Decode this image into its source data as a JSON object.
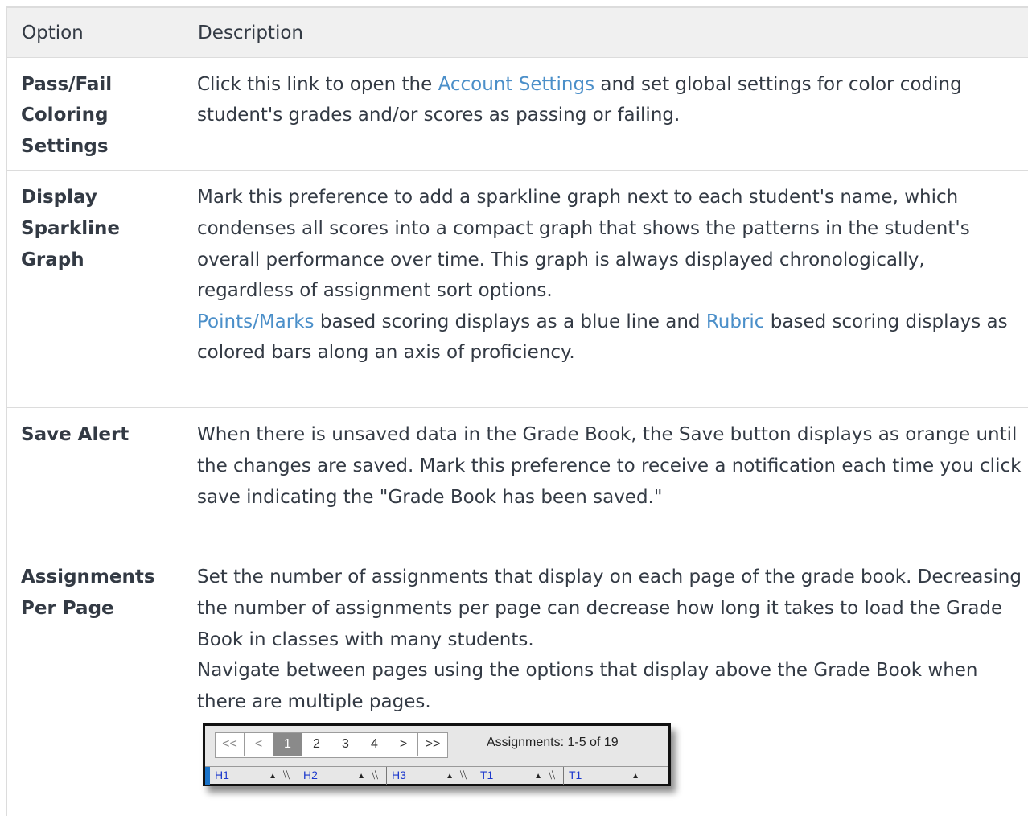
{
  "table": {
    "headers": {
      "option": "Option",
      "description": "Description"
    },
    "rows": {
      "pass_fail": {
        "option": "Pass/Fail Coloring Settings",
        "desc_before": "Click this link to open the ",
        "desc_link": "Account Settings",
        "desc_after": " and set global settings for color coding student's grades and/or scores as passing or failing."
      },
      "sparkline": {
        "option": "Display Sparkline Graph",
        "desc_p1": "Mark this preference to add a sparkline graph next to each student's name, which condenses all scores into a compact graph that shows the patterns in the student's overall performance over time. This graph is always displayed chronologically, regardless of assignment sort options.",
        "link1": "Points/Marks",
        "mid": " based scoring displays as a blue line and ",
        "link2": "Rubric",
        "end": " based scoring displays as colored bars along an axis of proficiency."
      },
      "save_alert": {
        "option": "Save Alert",
        "desc": "When there is unsaved data in the Grade Book, the Save button displays as orange until the changes are saved. Mark this preference to receive a notification each time you click save indicating the \"Grade Book has been saved.\""
      },
      "assignments": {
        "option": "Assignments Per Page",
        "desc_p1": "Set the number of assignments that display on each page of the grade book. Decreasing the number of assignments per page can decrease how long it takes to load the Grade Book in classes with many students.",
        "desc_p2": "Navigate between pages using the options that display above the Grade Book when there are multiple pages."
      }
    }
  },
  "pager_image": {
    "buttons": {
      "first": "<<",
      "prev": "<",
      "p1": "1",
      "p2": "2",
      "p3": "3",
      "p4": "4",
      "next": ">",
      "last": ">>"
    },
    "assignments_label": "Assignments: 1-5 of 19",
    "columns": {
      "c1": "H1",
      "c2": "H2",
      "c3": "H3",
      "c4": "T1",
      "c5": "T1"
    },
    "sort_glyph": "▲",
    "clip_glyph": "⧹⧹"
  }
}
